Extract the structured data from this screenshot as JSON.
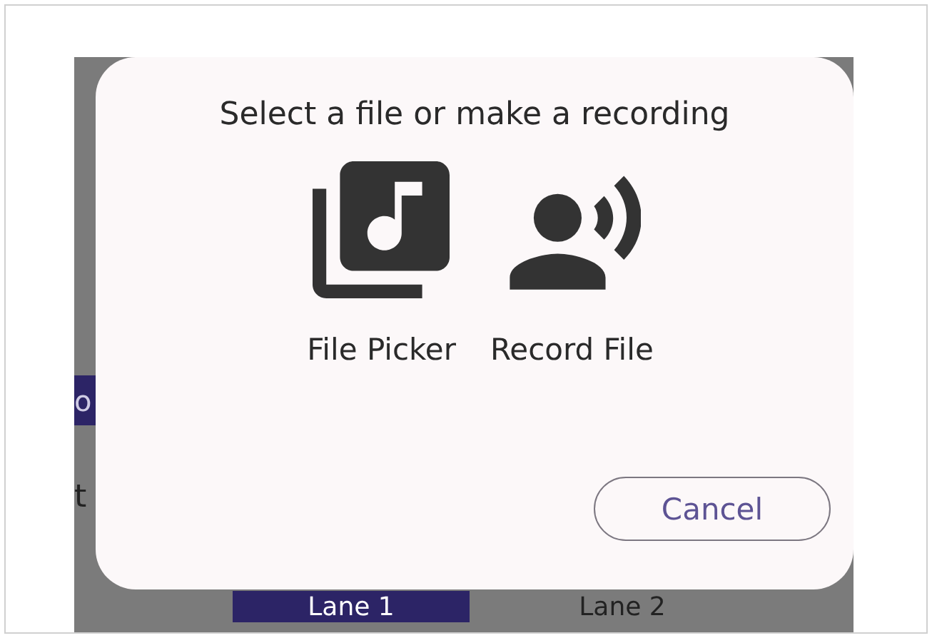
{
  "background": {
    "bar_text": "o",
    "line_text": "t",
    "lanes": [
      {
        "label": "Lane 1",
        "selected": true
      },
      {
        "label": "Lane 2",
        "selected": false
      }
    ]
  },
  "dialog": {
    "title": "Select a file or make a recording",
    "options": [
      {
        "kind": "file",
        "label": "File Picker"
      },
      {
        "kind": "record",
        "label": "Record File"
      }
    ],
    "cancel": "Cancel"
  }
}
